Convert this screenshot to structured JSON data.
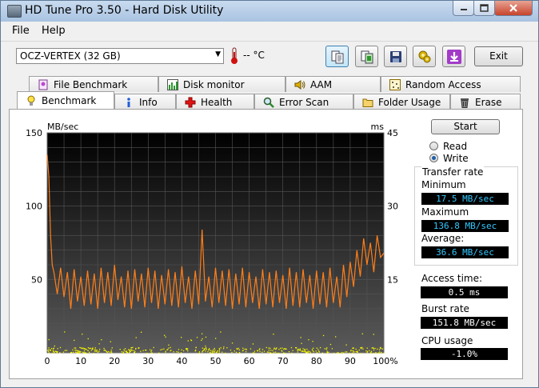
{
  "window": {
    "title": "HD Tune Pro 3.50 - Hard Disk Utility"
  },
  "menu": {
    "items": [
      "File",
      "Help"
    ]
  },
  "toolbar": {
    "drive": "OCZ-VERTEX (32 GB)",
    "temperature": "-- °C",
    "exit_label": "Exit",
    "buttons": [
      "copy-text-icon",
      "copy-screen-icon",
      "save-icon",
      "options-icon",
      "download-icon"
    ]
  },
  "tabs": {
    "row1": [
      "File Benchmark",
      "Disk monitor",
      "AAM",
      "Random Access"
    ],
    "row2": [
      "Benchmark",
      "Info",
      "Health",
      "Error Scan",
      "Folder Usage",
      "Erase"
    ],
    "selected": "Benchmark"
  },
  "controls": {
    "start_label": "Start",
    "read_label": "Read",
    "write_label": "Write",
    "mode": "Write"
  },
  "stats": {
    "transfer_rate_label": "Transfer rate",
    "minimum_label": "Minimum",
    "minimum": "17.5 MB/sec",
    "maximum_label": "Maximum",
    "maximum": "136.8 MB/sec",
    "average_label": "Average:",
    "average": "36.6 MB/sec",
    "access_time_label": "Access time:",
    "access_time": "0.5 ms",
    "burst_rate_label": "Burst rate",
    "burst_rate": "151.8 MB/sec",
    "cpu_usage_label": "CPU usage",
    "cpu_usage": "-1.0%"
  },
  "colors": {
    "transfer_line": "#ff7f1a",
    "access_points": "#f5f500",
    "chart_background_top": "#000000",
    "chart_background_bottom": "#5a5a5a",
    "grid": "#555555"
  },
  "chart_data": {
    "type": "line",
    "y_left_label": "MB/sec",
    "y_right_label": "ms",
    "ylim_left": [
      0,
      150
    ],
    "ylim_right": [
      0,
      45
    ],
    "xlim": [
      0,
      100
    ],
    "y_left_ticks": [
      "150",
      "100",
      "50"
    ],
    "y_right_ticks": [
      "45",
      "30",
      "15"
    ],
    "x_ticks": [
      "0",
      "10",
      "20",
      "30",
      "40",
      "50",
      "60",
      "70",
      "80",
      "90",
      "100%"
    ],
    "grid": true,
    "series": [
      {
        "role": "transfer_rate",
        "axis": "left",
        "x": [
          0,
          0.5,
          1,
          1.5,
          2,
          3,
          4,
          5,
          6,
          7,
          8,
          9,
          10,
          11,
          12,
          13,
          14,
          15,
          16,
          17,
          18,
          19,
          20,
          21,
          22,
          23,
          24,
          25,
          26,
          27,
          28,
          29,
          30,
          31,
          32,
          33,
          34,
          35,
          36,
          37,
          38,
          39,
          40,
          41,
          42,
          43,
          44,
          45,
          46,
          46.5,
          47,
          48,
          49,
          50,
          51,
          52,
          53,
          54,
          55,
          56,
          57,
          58,
          59,
          60,
          61,
          62,
          63,
          64,
          65,
          66,
          67,
          68,
          69,
          70,
          71,
          72,
          73,
          74,
          75,
          76,
          77,
          78,
          79,
          80,
          81,
          82,
          83,
          84,
          85,
          86,
          87,
          88,
          89,
          90,
          91,
          92,
          93,
          94,
          95,
          96,
          97,
          98,
          99,
          100
        ],
        "y": [
          135,
          120,
          80,
          60,
          55,
          40,
          58,
          38,
          55,
          30,
          57,
          35,
          52,
          32,
          56,
          33,
          54,
          30,
          58,
          34,
          55,
          32,
          60,
          36,
          52,
          31,
          56,
          30,
          57,
          35,
          54,
          31,
          58,
          34,
          56,
          30,
          53,
          33,
          57,
          32,
          55,
          31,
          59,
          34,
          52,
          30,
          56,
          33,
          84,
          60,
          35,
          52,
          31,
          58,
          34,
          56,
          32,
          57,
          30,
          54,
          33,
          58,
          31,
          55,
          34,
          52,
          30,
          57,
          33,
          55,
          31,
          56,
          34,
          53,
          30,
          58,
          32,
          55,
          31,
          57,
          34,
          53,
          30,
          56,
          33,
          55,
          31,
          58,
          34,
          52,
          31,
          60,
          38,
          62,
          45,
          70,
          52,
          78,
          60,
          75,
          55,
          80,
          65,
          68
        ]
      },
      {
        "role": "access_time",
        "axis": "right",
        "type": "scatter",
        "note_values": "points mostly between 0 and 4 ms"
      }
    ]
  }
}
